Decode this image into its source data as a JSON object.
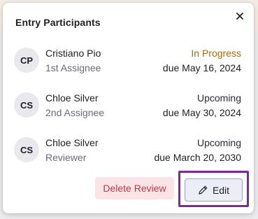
{
  "popover": {
    "title": "Entry Participants"
  },
  "participants": [
    {
      "initials": "CP",
      "name": "Cristiano Pio",
      "role": "1st Assignee",
      "status": "In Progress",
      "due": "due May 16, 2024"
    },
    {
      "initials": "CS",
      "name": "Chloe Silver",
      "role": "2nd Assignee",
      "status": "Upcoming",
      "due": "due May 30, 2024"
    },
    {
      "initials": "CS",
      "name": "Chloe Silver",
      "role": "Reviewer",
      "status": "Upcoming",
      "due": "due March 20, 2030"
    }
  ],
  "actions": {
    "delete_label": "Delete Review",
    "edit_label": "Edit"
  },
  "colors": {
    "in_progress": "#a36a12",
    "delete_bg": "#fbe4e6",
    "delete_text": "#c23645",
    "highlight": "#7b2a9a"
  },
  "icons": {
    "close": "close-icon",
    "edit": "pencil-icon"
  }
}
